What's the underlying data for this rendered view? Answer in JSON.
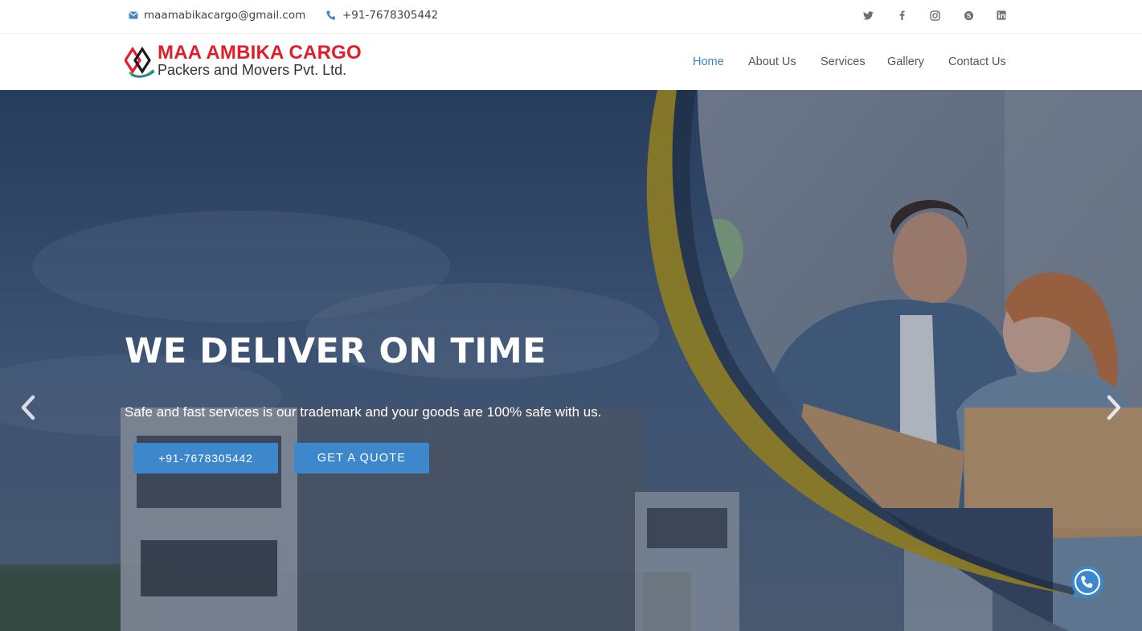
{
  "topbar": {
    "email": "maamabikacargo@gmail.com",
    "phone": "+91-7678305442",
    "email_icon": "envelope-icon",
    "phone_icon": "phone-icon",
    "social": [
      "twitter-icon",
      "facebook-icon",
      "instagram-icon",
      "skype-icon",
      "linkedin-icon"
    ]
  },
  "header": {
    "logo_title": "MAA AMBIKA CARGO",
    "logo_subtitle": "Packers and Movers Pvt. Ltd.",
    "nav": [
      {
        "label": "Home",
        "active": true
      },
      {
        "label": "About Us"
      },
      {
        "label": "Services"
      },
      {
        "label": "Gallery"
      },
      {
        "label": "Contact Us"
      }
    ]
  },
  "hero": {
    "title": "WE DELIVER ON TIME",
    "subtitle": "Safe and fast services is our trademark and your goods are 100% safe with us.",
    "buttons": {
      "phone_label": "+91-7678305442",
      "quote_label": "GET A QUOTE"
    },
    "prev_icon": "chevron-left-icon",
    "next_icon": "chevron-right-icon",
    "whatsapp_icon": "whatsapp-icon"
  },
  "colors": {
    "brand_red": "#e11d2a",
    "accent_blue": "#3d87cc",
    "nav_active": "#3b82c4",
    "arc_gold": "#b59a1a"
  }
}
